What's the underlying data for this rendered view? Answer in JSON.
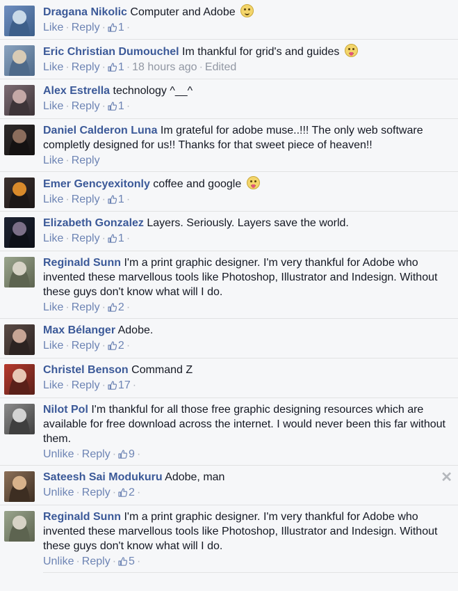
{
  "comments": [
    {
      "author": "Dragana Nikolic",
      "text": "Computer and Adobe",
      "emoji": "smile",
      "like_label": "Like",
      "reply_label": "Reply",
      "likes": "1",
      "time": "",
      "edited": "",
      "avatar_colors": [
        "#6f8ec0",
        "#c9d9e8",
        "#3d5f8a"
      ]
    },
    {
      "author": "Eric Christian Dumouchel",
      "text": "Im thankful for grid's and guides",
      "emoji": "tongue",
      "like_label": "Like",
      "reply_label": "Reply",
      "likes": "1",
      "time": "18 hours ago",
      "edited": "Edited",
      "avatar_colors": [
        "#8aa3bf",
        "#d8cbb5",
        "#4e6a8a"
      ]
    },
    {
      "author": "Alex Estrella",
      "text": "technology ^__^",
      "emoji": "",
      "like_label": "Like",
      "reply_label": "Reply",
      "likes": "1",
      "time": "",
      "edited": "",
      "avatar_colors": [
        "#7d6c74",
        "#c4a8a6",
        "#3d3438"
      ]
    },
    {
      "author": "Daniel Calderon Luna",
      "text": "Im grateful for adobe muse..!!! The only web software completly designed for us!! Thanks for that sweet piece of heaven!!",
      "emoji": "",
      "like_label": "Like",
      "reply_label": "Reply",
      "likes": "",
      "time": "",
      "edited": "",
      "avatar_colors": [
        "#2e2a2a",
        "#8b6d5c",
        "#141212"
      ]
    },
    {
      "author": "Emer Gencyexitonly",
      "text": "coffee and google",
      "emoji": "tongue",
      "like_label": "Like",
      "reply_label": "Reply",
      "likes": "1",
      "time": "",
      "edited": "",
      "avatar_colors": [
        "#3b3130",
        "#d98a2b",
        "#1c1717"
      ]
    },
    {
      "author": "Elizabeth Gonzalez",
      "text": "Layers. Seriously. Layers save the world.",
      "emoji": "",
      "like_label": "Like",
      "reply_label": "Reply",
      "likes": "1",
      "time": "",
      "edited": "",
      "avatar_colors": [
        "#1d2333",
        "#7b6f88",
        "#0d1018"
      ]
    },
    {
      "author": "Reginald Sunn",
      "text": "I'm a print graphic designer. I'm very thankful for Adobe who invented these marvellous tools like Photoshop, Illustrator and Indesign. Without these guys don't know what will I do.",
      "emoji": "",
      "like_label": "Like",
      "reply_label": "Reply",
      "likes": "2",
      "time": "",
      "edited": "",
      "avatar_colors": [
        "#9aa58d",
        "#d7d3c6",
        "#5d6450"
      ]
    },
    {
      "author": "Max Bélanger",
      "text": "Adobe.",
      "emoji": "",
      "like_label": "Like",
      "reply_label": "Reply",
      "likes": "2",
      "time": "",
      "edited": "",
      "avatar_colors": [
        "#5a4b46",
        "#c7a595",
        "#2c2321"
      ]
    },
    {
      "author": "Christel Benson",
      "text": "Command Z",
      "emoji": "",
      "like_label": "Like",
      "reply_label": "Reply",
      "likes": "17",
      "time": "",
      "edited": "",
      "avatar_colors": [
        "#b73a2e",
        "#e7c7b4",
        "#5a2019"
      ]
    },
    {
      "author": "Nilot Pol",
      "text": "I'm thankful for all those free graphic designing resources which are available for free download across the internet. I would never been this far without them.",
      "emoji": "",
      "like_label": "Unlike",
      "reply_label": "Reply",
      "likes": "9",
      "time": "",
      "edited": "",
      "avatar_colors": [
        "#8c8c8c",
        "#d3d3d3",
        "#3f3f3f"
      ]
    },
    {
      "author": "Sateesh Sai Modukuru",
      "text": "Adobe, man",
      "emoji": "",
      "like_label": "Unlike",
      "reply_label": "Reply",
      "likes": "2",
      "time": "",
      "edited": "",
      "avatar_colors": [
        "#8c7058",
        "#d7b28b",
        "#3d2e22"
      ],
      "closable": true
    },
    {
      "author": "Reginald Sunn",
      "text": "I'm a print graphic designer. I'm very thankful for Adobe who invented these marvellous tools like Photoshop, Illustrator and Indesign. Without these guys don't know what will I do.",
      "emoji": "",
      "like_label": "Unlike",
      "reply_label": "Reply",
      "likes": "5",
      "time": "",
      "edited": "",
      "avatar_colors": [
        "#9aa58d",
        "#d7d3c6",
        "#5d6450"
      ]
    }
  ],
  "close_glyph": "✕",
  "dot": "·",
  "colors": {
    "author": "#3b5998",
    "action": "#6d84b4",
    "muted": "#9197a3",
    "background": "#f6f7f9"
  }
}
